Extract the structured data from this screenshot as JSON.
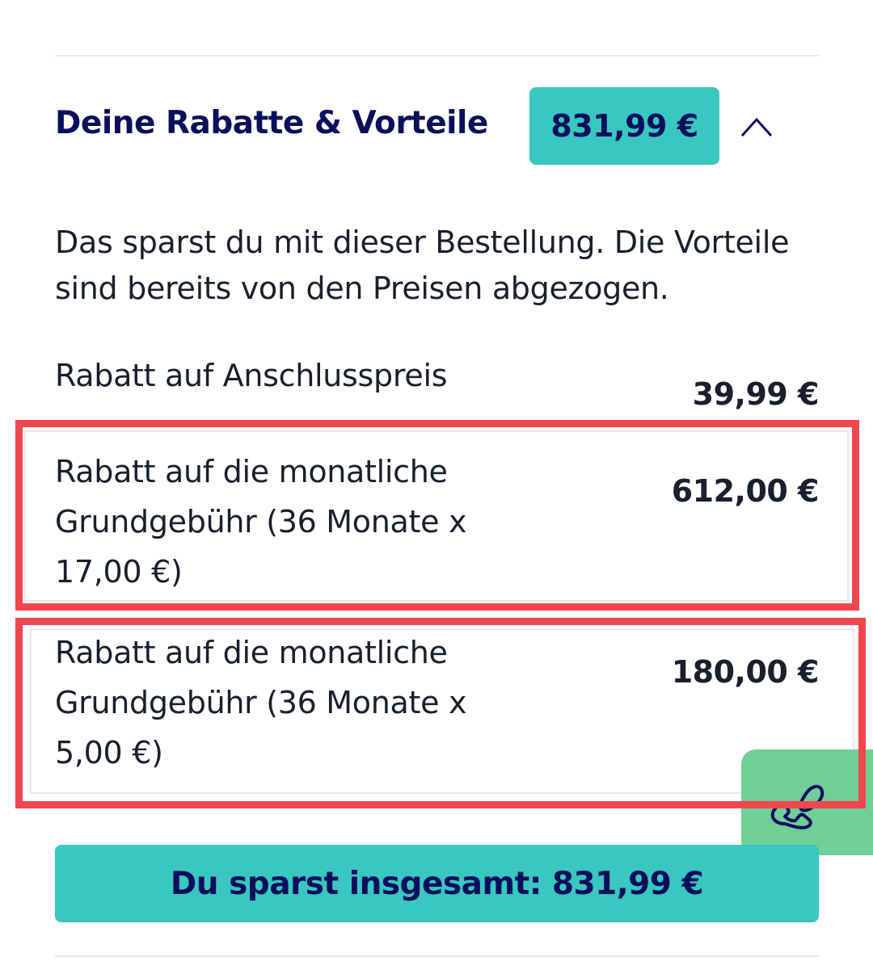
{
  "header": {
    "title": "Deine Rabatte & Vorteile",
    "total_badge": "831,99 €",
    "toggle_icon": "chevron-up-icon"
  },
  "intro": {
    "text": "Das sparst du mit dieser Bestellung. Die Vorteile sind bereits von den Preisen abgezogen."
  },
  "discounts": [
    {
      "label": "Rabatt auf Anschlusspreis",
      "value": "39,99 €"
    },
    {
      "label_lines": [
        "Rabatt auf die monatliche",
        "Grundgebühr (36 Monate x",
        "17,00 €)"
      ],
      "value": "612,00 €"
    },
    {
      "label_lines": [
        "Rabatt auf die monatliche",
        "Grundgebühr (36 Monate x",
        "5,00 €)"
      ],
      "value": "180,00 €"
    }
  ],
  "summary": {
    "label": "Du sparst insgesamt: 831,99 €"
  },
  "contact": {
    "icon": "phone-icon"
  },
  "colors": {
    "accent": "#3ac6c1",
    "brand_navy": "#0a0f5c",
    "highlight_red": "#f2464f",
    "fab_green": "#6fcf97"
  }
}
